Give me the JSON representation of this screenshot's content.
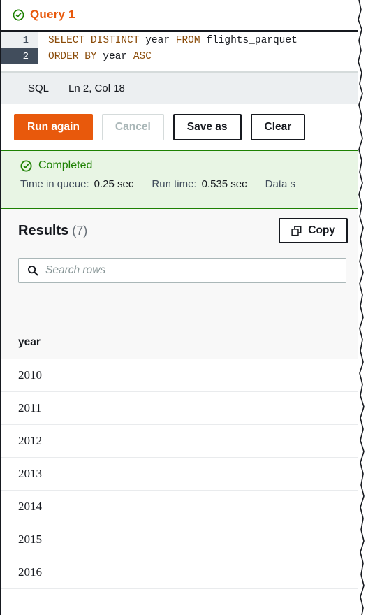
{
  "tab": {
    "label": "Query 1",
    "status_icon": "check-circle-icon"
  },
  "editor": {
    "lines": [
      {
        "number": "1",
        "keyword_a": "SELECT DISTINCT",
        "ident_a": " year ",
        "keyword_b": "FROM",
        "ident_b": " flights_parquet"
      },
      {
        "number": "2",
        "keyword_a": "ORDER BY",
        "ident_a": " year ",
        "keyword_b": "ASC",
        "ident_b": ""
      }
    ],
    "active_line": 2,
    "language": "SQL",
    "cursor_position": "Ln 2, Col 18"
  },
  "actions": {
    "run_again": "Run again",
    "cancel": "Cancel",
    "save_as": "Save as",
    "clear": "Clear"
  },
  "status_banner": {
    "state": "Completed",
    "time_in_queue_label": "Time in queue:",
    "time_in_queue_value": "0.25 sec",
    "run_time_label": "Run time:",
    "run_time_value": "0.535 sec",
    "data_scanned_label": "Data s"
  },
  "results": {
    "title": "Results",
    "count": "(7)",
    "copy_label": "Copy",
    "copy_icon": "copy-icon",
    "search_placeholder": "Search rows",
    "search_value": "",
    "search_icon": "search-icon",
    "columns": [
      "year"
    ],
    "rows": [
      [
        "2010"
      ],
      [
        "2011"
      ],
      [
        "2012"
      ],
      [
        "2013"
      ],
      [
        "2014"
      ],
      [
        "2015"
      ],
      [
        "2016"
      ]
    ]
  },
  "colors": {
    "accent_orange": "#e8590c",
    "success_green": "#1d8102",
    "banner_bg": "#e8f5e4",
    "ink": "#16191f",
    "gutter_active": "#414d5c"
  }
}
